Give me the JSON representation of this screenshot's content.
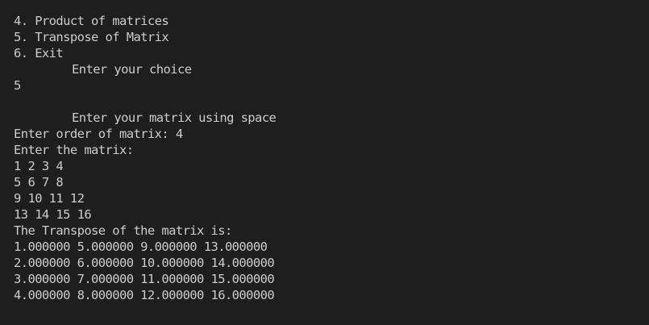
{
  "terminal": {
    "lines": [
      "4. Product of matrices",
      "5. Transpose of Matrix",
      "6. Exit",
      "Enter your choice",
      "5",
      "",
      "Enter your matrix using space",
      "Enter order of matrix: 4",
      "Enter the matrix:",
      "1 2 3 4",
      "5 6 7 8",
      "9 10 11 12",
      "13 14 15 16",
      "The Transpose of the matrix is:",
      "1.000000 5.000000 9.000000 13.000000",
      "2.000000 6.000000 10.000000 14.000000",
      "3.000000 7.000000 11.000000 15.000000",
      "4.000000 8.000000 12.000000 16.000000"
    ]
  },
  "colors": {
    "background": "#1e1e1e",
    "text": "#cccccc"
  }
}
